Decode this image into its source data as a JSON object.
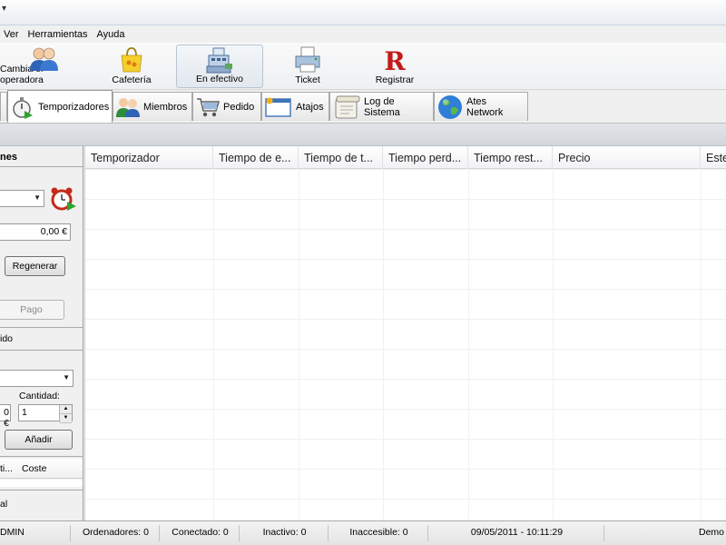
{
  "menu": [
    "Ver",
    "Herramientas",
    "Ayuda"
  ],
  "toolbar": {
    "operator": "Cambia el operadora",
    "cafe": "Cafetería",
    "cash": "En efectivo",
    "ticket": "Ticket",
    "register": "Registrar"
  },
  "tabs": [
    "Temporizadores",
    "Miembros",
    "Pedido",
    "Atajos",
    "Log de Sistema",
    "Ates Network"
  ],
  "left": {
    "header": "nes",
    "amount": "0,00 €",
    "regenerate": "Regenerar",
    "pay": "Pago",
    "section2": "ido",
    "quantity_label": "Cantidad:",
    "price_value": "0 €",
    "quantity_value": "1",
    "add": "Añadir",
    "col1": "ti...",
    "col2": "Coste",
    "total_label": "al"
  },
  "grid": {
    "columns": [
      "Temporizador",
      "Tiempo de e...",
      "Tiempo de t...",
      "Tiempo perd...",
      "Tiempo rest...",
      "Precio",
      "Este"
    ]
  },
  "status": {
    "user": "DMIN",
    "computers": "Ordenadores: 0",
    "connected": "Conectado: 0",
    "inactive": "Inactivo: 0",
    "inaccessible": "Inaccesible: 0",
    "datetime": "09/05/2011 - 10:11:29",
    "mode": "Demo"
  }
}
